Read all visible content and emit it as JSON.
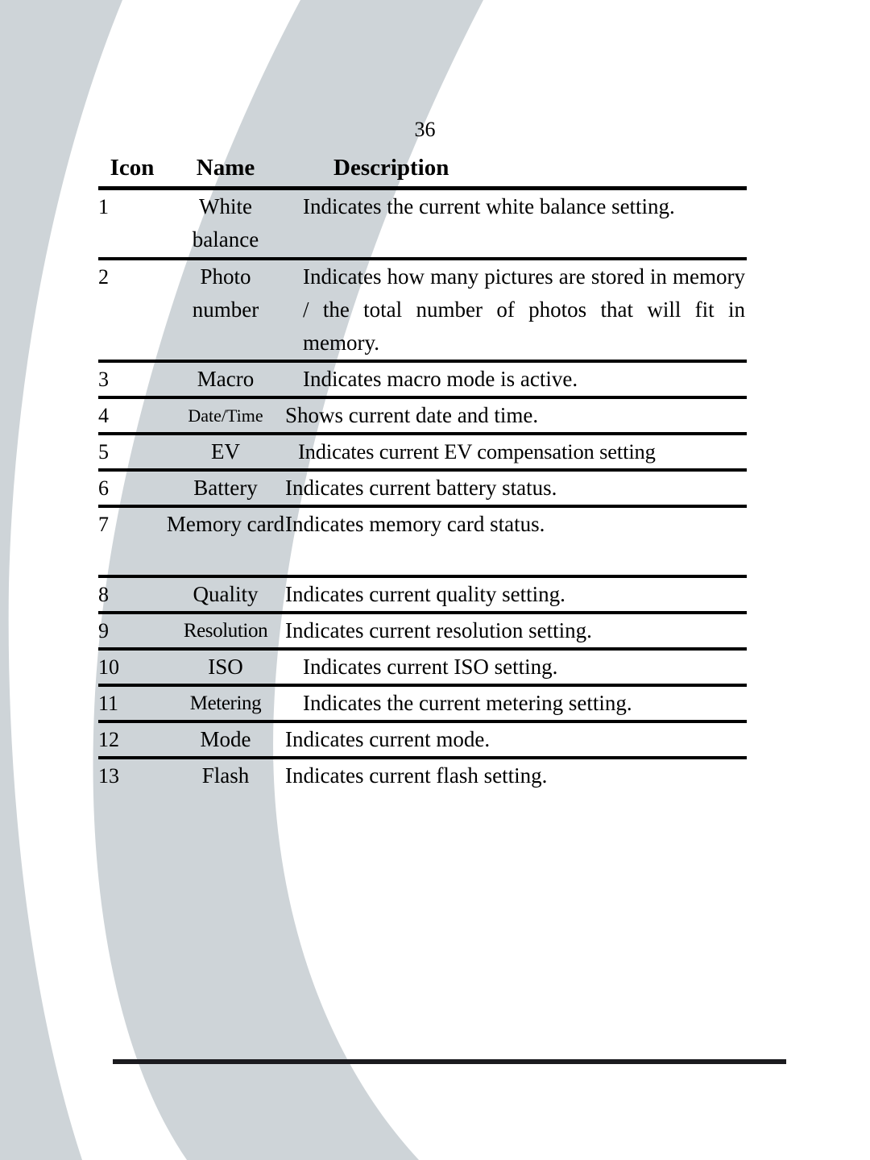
{
  "page": {
    "number": "36",
    "background_color": "#ffffff",
    "decor_color": "#ced4d8",
    "rule_color": "#1b1b1f"
  },
  "table": {
    "headers": {
      "icon": "Icon",
      "name": "Name",
      "description": "Description"
    },
    "rows": [
      {
        "icon": "1",
        "name": "White balance",
        "description": "Indicates the current white balance setting."
      },
      {
        "icon": "2",
        "name": "Photo number",
        "description": "Indicates how many pictures are stored in memory / the total number of photos that will fit in memory."
      },
      {
        "icon": "3",
        "name": "Macro",
        "description": "Indicates macro mode is active."
      },
      {
        "icon": "4",
        "name": "Date/Time",
        "description": "Shows current date and time."
      },
      {
        "icon": "5",
        "name": "EV",
        "description": "Indicates current EV compensation setting"
      },
      {
        "icon": "6",
        "name": "Battery",
        "description": "Indicates current battery status."
      },
      {
        "icon": "7",
        "name": "Memory card",
        "description": "Indicates memory card status."
      },
      {
        "icon": "8",
        "name": "Quality",
        "description": "Indicates current quality setting."
      },
      {
        "icon": "9",
        "name": "Resolution",
        "description": "Indicates current resolution setting."
      },
      {
        "icon": "10",
        "name": "ISO",
        "description": "Indicates current ISO setting."
      },
      {
        "icon": "11",
        "name": "Metering",
        "description": "Indicates the current metering setting."
      },
      {
        "icon": "12",
        "name": "Mode",
        "description": "Indicates current mode."
      },
      {
        "icon": "13",
        "name": "Flash",
        "description": "Indicates current flash setting."
      }
    ]
  }
}
